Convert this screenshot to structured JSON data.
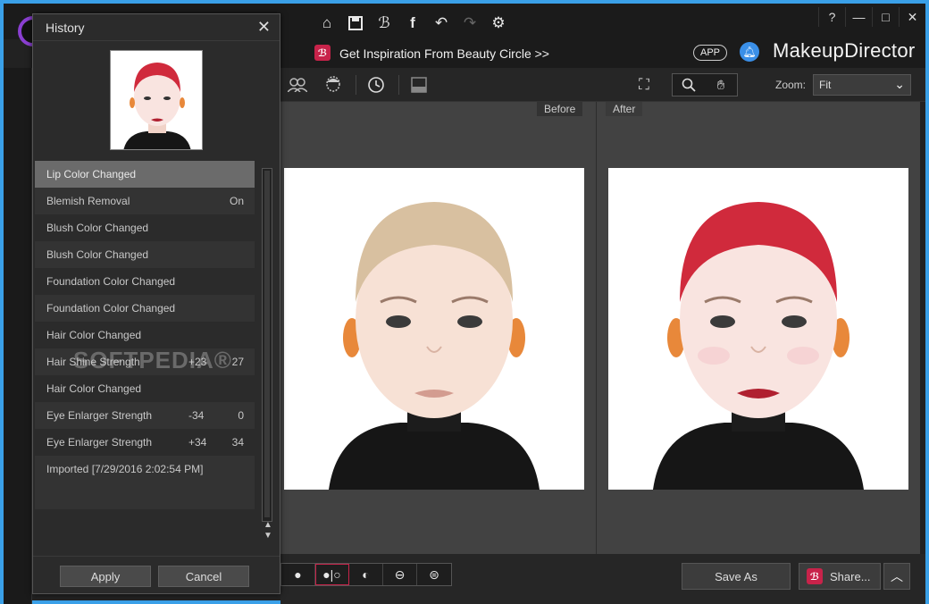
{
  "titlebar": {
    "brand": "MakeupDirector",
    "app_badge": "APP",
    "inspire_text": "Get Inspiration From Beauty Circle >>",
    "beauty_icon_char": "ℬ",
    "icons": [
      "home-icon",
      "save-icon",
      "beauty-circle-icon",
      "facebook-icon",
      "undo-icon",
      "redo-icon",
      "settings-icon"
    ],
    "help": "?",
    "minimize": "—",
    "maximize": "□",
    "close": "✕"
  },
  "toolbar2": {
    "zoom_label": "Zoom:",
    "zoom_value": "Fit"
  },
  "viewer": {
    "before_label": "Before",
    "after_label": "After"
  },
  "bottombar": {
    "save_as": "Save As",
    "share": "Share...",
    "share_icon_char": "ℬ"
  },
  "dialog": {
    "title": "History",
    "apply": "Apply",
    "cancel": "Cancel",
    "items": [
      {
        "label": "Lip Color Changed",
        "v1": "",
        "v2": "",
        "selected": true
      },
      {
        "label": "Blemish Removal",
        "v1": "",
        "v2": "On"
      },
      {
        "label": "Blush Color Changed",
        "v1": "",
        "v2": ""
      },
      {
        "label": "Blush Color Changed",
        "v1": "",
        "v2": ""
      },
      {
        "label": "Foundation Color Changed",
        "v1": "",
        "v2": ""
      },
      {
        "label": "Foundation Color Changed",
        "v1": "",
        "v2": ""
      },
      {
        "label": "Hair Color Changed",
        "v1": "",
        "v2": ""
      },
      {
        "label": "Hair Shine Strength",
        "v1": "+23",
        "v2": "27"
      },
      {
        "label": "Hair Color Changed",
        "v1": "",
        "v2": ""
      },
      {
        "label": "Eye Enlarger Strength",
        "v1": "-34",
        "v2": "0"
      },
      {
        "label": "Eye Enlarger Strength",
        "v1": "+34",
        "v2": "34"
      },
      {
        "label": "Imported [7/29/2016 2:02:54 PM]",
        "v1": "",
        "v2": ""
      }
    ]
  },
  "watermark": "SOFTPEDIA®",
  "colors": {
    "accent_border": "#3aa0e8",
    "brand_pink": "#c8234a",
    "hair_after": "#d02a3c",
    "hair_before": "#d8c0a0"
  }
}
